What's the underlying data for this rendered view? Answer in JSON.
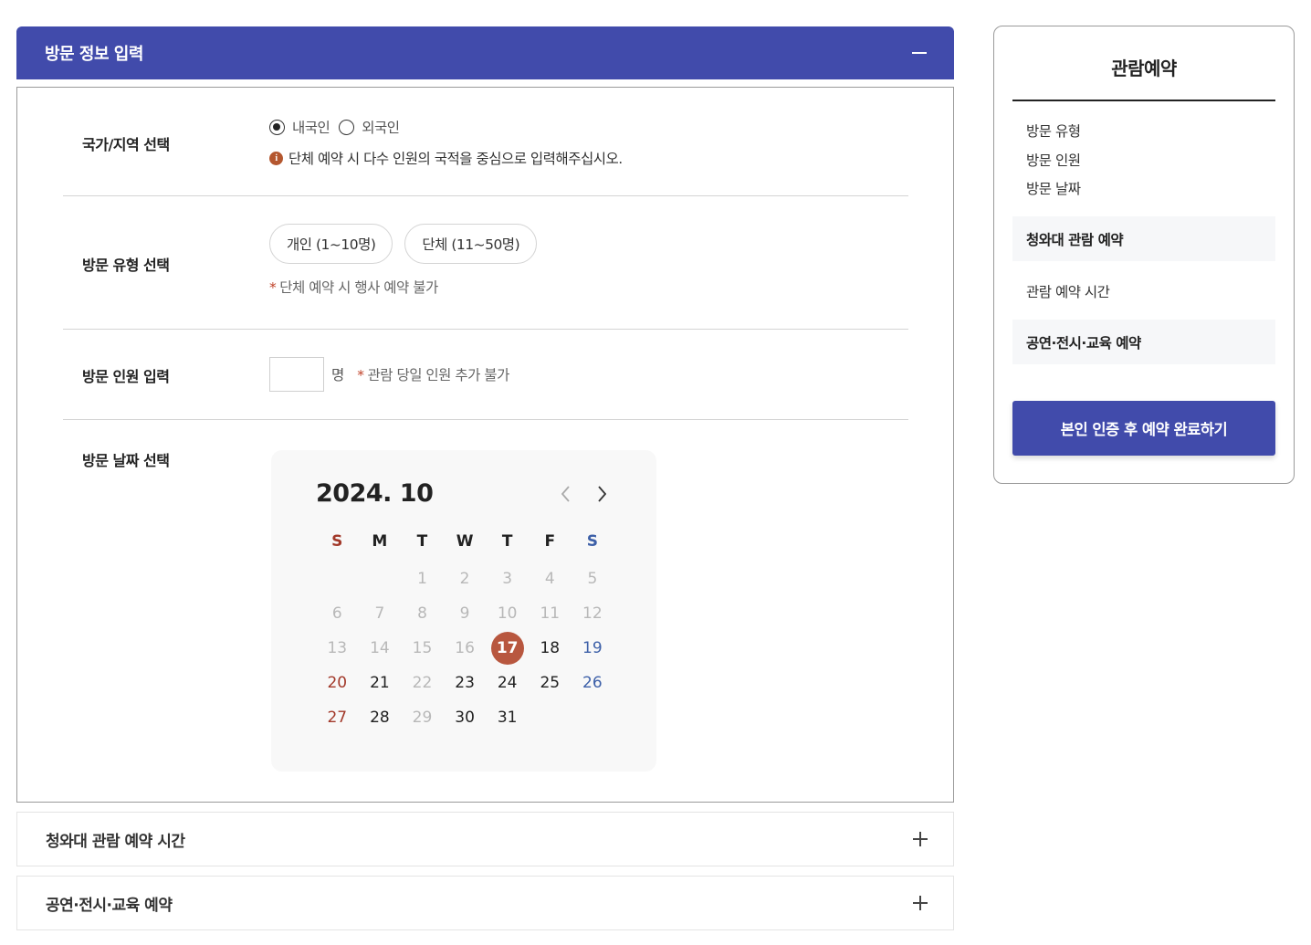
{
  "visit_info": {
    "header_title": "방문 정보 입력",
    "country": {
      "label": "국가/지역 선택",
      "options": [
        "내국인",
        "외국인"
      ],
      "selected": "내국인",
      "note": "단체 예약 시 다수 인원의 국적을 중심으로 입력해주십시오."
    },
    "visit_type": {
      "label": "방문 유형 선택",
      "options": [
        "개인 (1~10명)",
        "단체 (11~50명)"
      ],
      "note_star": "*",
      "note": "단체 예약 시 행사 예약 불가"
    },
    "people": {
      "label": "방문 인원 입력",
      "value": "",
      "unit": "명",
      "note_star": "*",
      "note": "관람 당일 인원 추가 불가"
    },
    "date": {
      "label": "방문 날짜 선택",
      "calendar": {
        "title": "2024. 10",
        "weekdays": [
          "S",
          "M",
          "T",
          "W",
          "T",
          "F",
          "S"
        ],
        "first_weekday": 2,
        "days_in_month": 31,
        "disabled_days": [
          1,
          2,
          3,
          4,
          5,
          6,
          7,
          8,
          9,
          10,
          11,
          12,
          13,
          14,
          15,
          16,
          22,
          29
        ],
        "selected_day": 17,
        "colors": {
          "sunday": "#a2392a",
          "saturday": "#3d60a8",
          "selected": "#b8573f",
          "disabled": "#b8b8b8"
        }
      }
    }
  },
  "accordions": [
    {
      "title": "청와대 관람 예약 시간"
    },
    {
      "title": "공연·전시·교육 예약"
    }
  ],
  "summary": {
    "title": "관람예약",
    "items": [
      "방문 유형",
      "방문 인원",
      "방문 날짜"
    ],
    "box1": "청와대 관람 예약",
    "plain": "관람 예약 시간",
    "box2": "공연·전시·교육 예약",
    "button": "본인 인증 후 예약 완료하기"
  },
  "theme": {
    "primary": "#414bab",
    "accent": "#b4572f"
  }
}
